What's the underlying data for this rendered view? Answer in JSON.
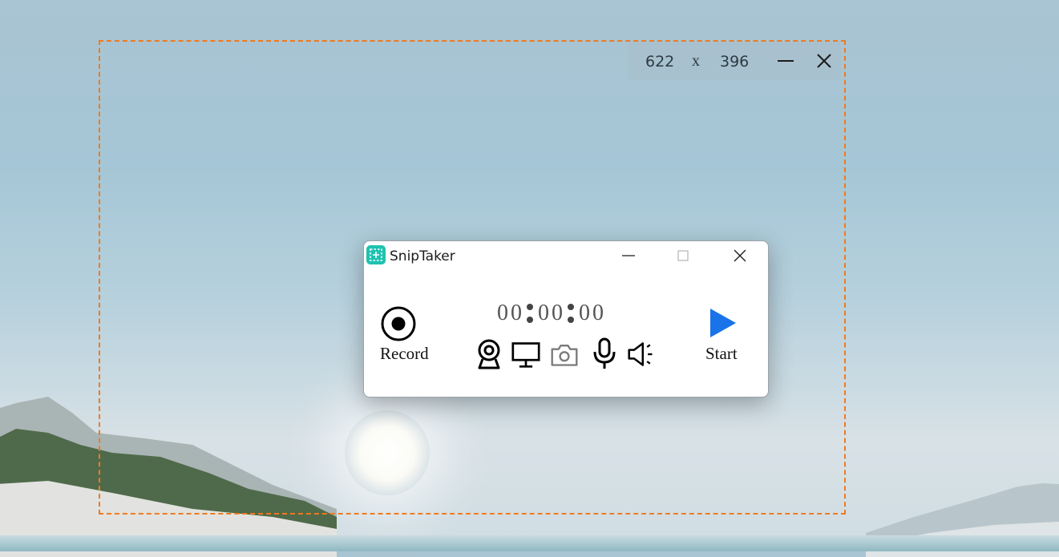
{
  "selection": {
    "width_value": "622",
    "separator": "x",
    "height_value": "396",
    "color": "#f07a1e"
  },
  "window": {
    "title": "SnipTaker",
    "icon": "sniptaker-app-icon",
    "accent": "#1fc2b0"
  },
  "controls": {
    "record_label": "Record",
    "start_label": "Start",
    "start_color": "#1a73e8"
  },
  "timer": {
    "hours": "00",
    "minutes": "00",
    "seconds": "00"
  },
  "sources": [
    {
      "icon": "webcam-icon"
    },
    {
      "icon": "screen-icon"
    },
    {
      "icon": "camera-icon",
      "state": "disabled"
    },
    {
      "icon": "microphone-icon"
    },
    {
      "icon": "speaker-icon"
    }
  ]
}
